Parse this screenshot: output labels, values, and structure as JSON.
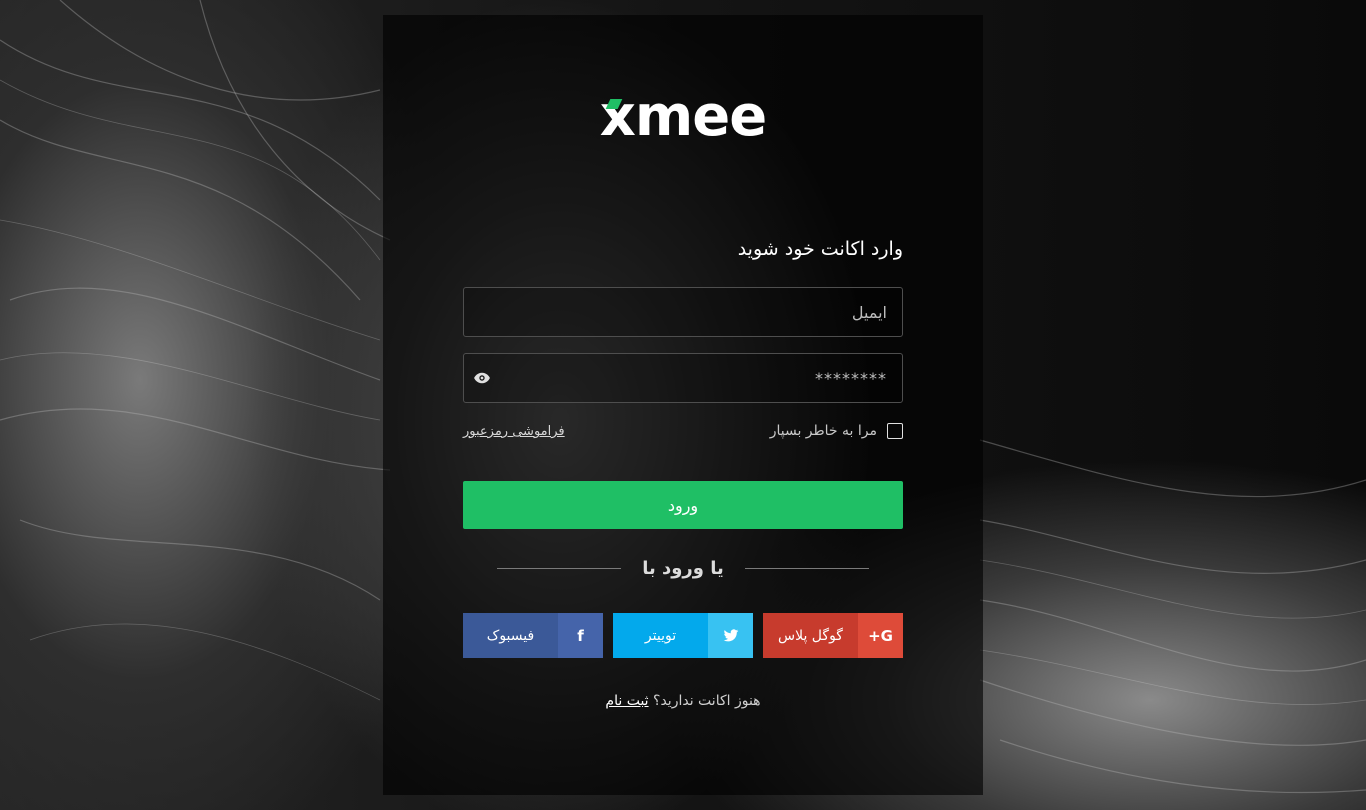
{
  "brand": {
    "logo_text": "xmee",
    "accent_color": "#1fbf65"
  },
  "login": {
    "title": "وارد اکانت خود شوید",
    "email_placeholder": "ایمیل",
    "password_value": "********",
    "remember_label": "مرا به خاطر بسپار",
    "remember_checked": false,
    "forgot_label": "فراموشی رمزعبور",
    "submit_label": "ورود",
    "divider_label": "یا ورود با"
  },
  "social": {
    "google": {
      "label": "گوگل پلاس",
      "icon": "google-plus-icon",
      "color": "#c73b2d"
    },
    "twitter": {
      "label": "توییتر",
      "icon": "twitter-icon",
      "color": "#03a9ec"
    },
    "facebook": {
      "label": "فیسبوک",
      "icon": "facebook-icon",
      "color": "#3b5998"
    }
  },
  "signup": {
    "question": "هنوز اکانت ندارید؟",
    "link_label": "ثبت نام"
  }
}
